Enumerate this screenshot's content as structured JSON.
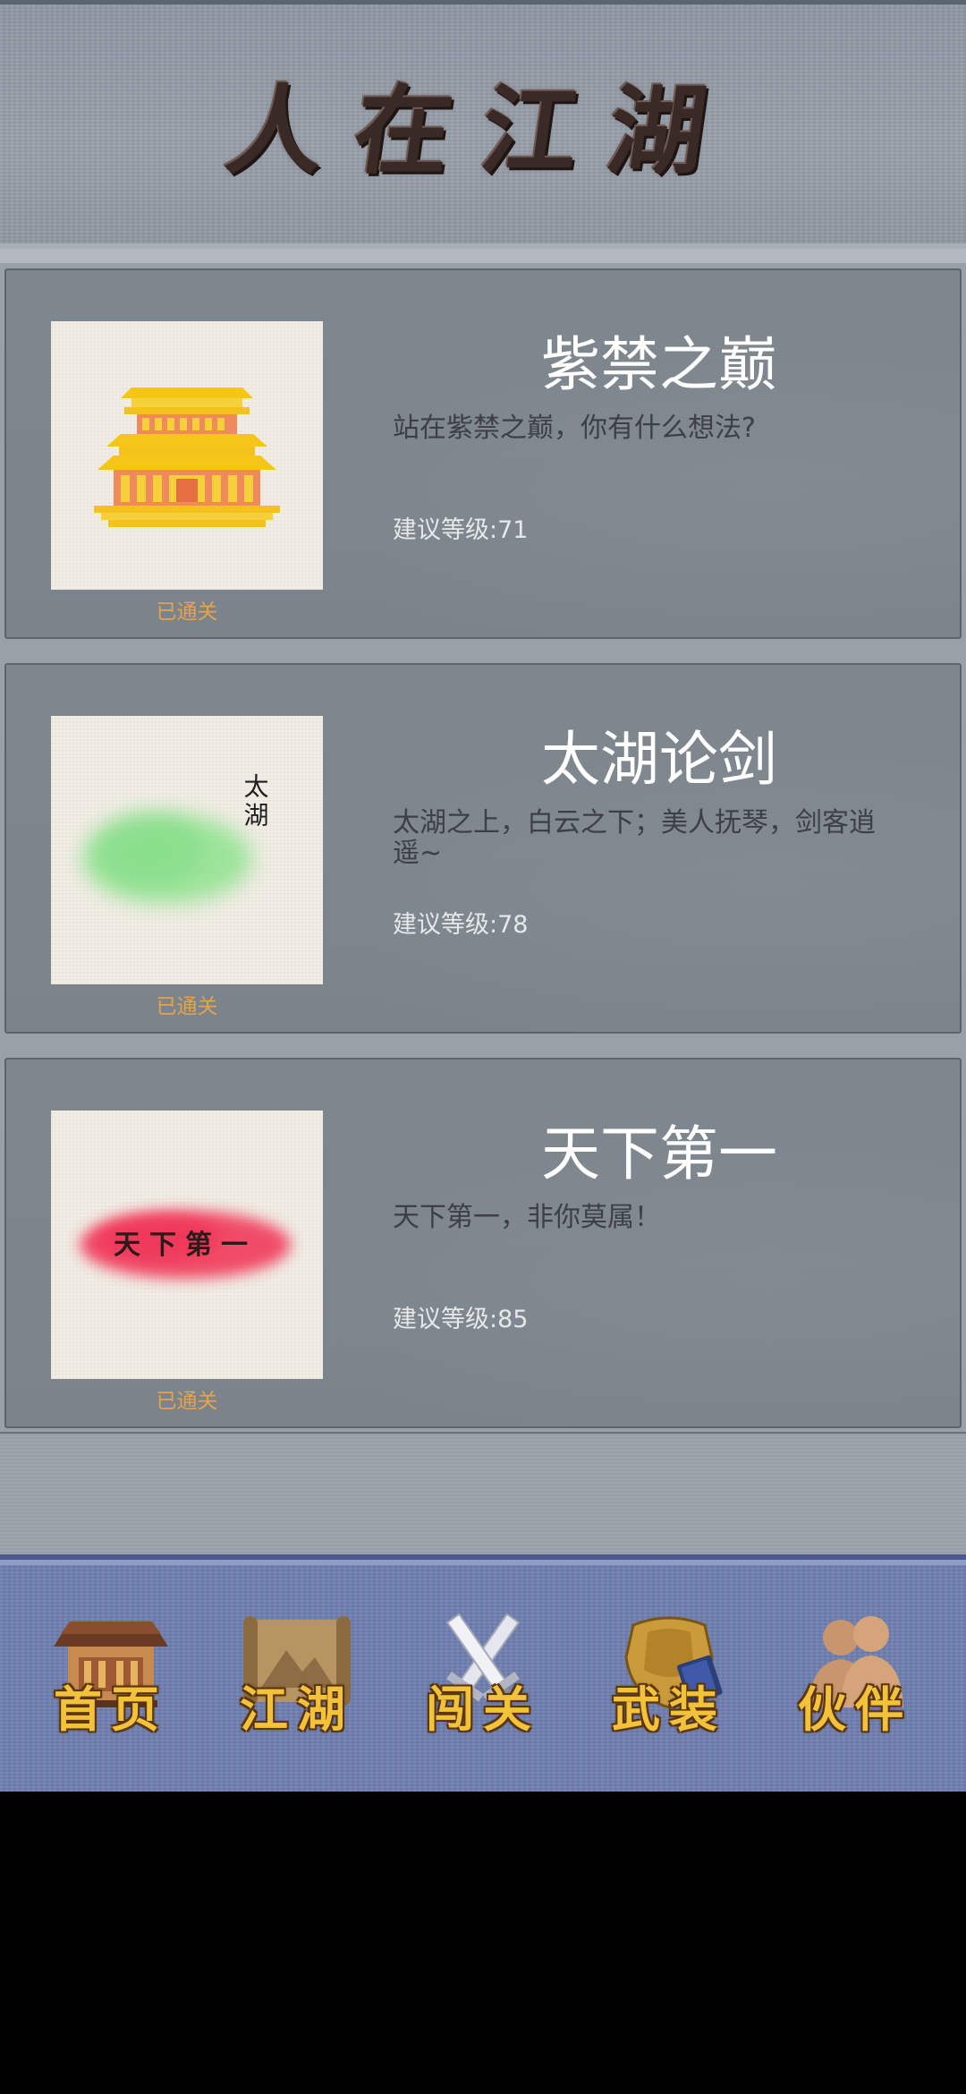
{
  "header": {
    "title": "人在江湖"
  },
  "levels": [
    {
      "name": "紫禁之巅",
      "description": "站在紫禁之巅，你有什么想法?",
      "recommended": "建议等级:71",
      "status": "已通关",
      "thumb_icon": "palace-icon"
    },
    {
      "name": "太湖论剑",
      "description": "太湖之上，白云之下；美人抚琴，剑客逍遥~",
      "recommended": "建议等级:78",
      "status": "已通关",
      "thumb_icon": "lake-ink-icon",
      "thumb_text": "太湖"
    },
    {
      "name": "天下第一",
      "description": "天下第一，非你莫属！",
      "recommended": "建议等级:85",
      "status": "已通关",
      "thumb_icon": "red-ink-icon",
      "thumb_text": "天下第一"
    }
  ],
  "bottom_nav": {
    "items": [
      {
        "label": "首页",
        "icon": "house-icon"
      },
      {
        "label": "江湖",
        "icon": "scroll-map-icon"
      },
      {
        "label": "闯关",
        "icon": "crossed-swords-icon"
      },
      {
        "label": "武装",
        "icon": "armor-icon"
      },
      {
        "label": "伙伴",
        "icon": "companions-icon"
      }
    ]
  },
  "colors": {
    "status": "#e7a24a",
    "nav_label": "#f2c23a",
    "nav_bg": "#6f7fb0",
    "card_bg": "#7e868e"
  }
}
